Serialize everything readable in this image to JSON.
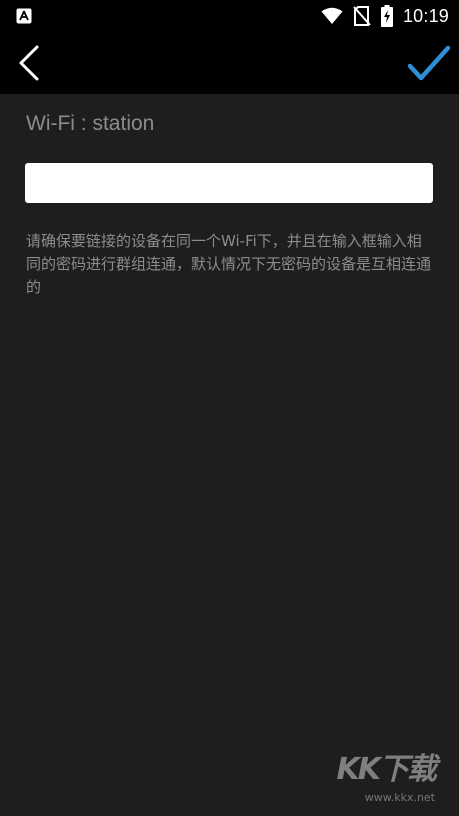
{
  "status_bar": {
    "time": "10:19",
    "icons": [
      "app-notification-icon",
      "wifi-icon",
      "no-sim-icon",
      "battery-charging-icon"
    ]
  },
  "toolbar": {
    "back_icon": "chevron-left-icon",
    "confirm_icon": "checkmark-icon",
    "accent_color": "#2f8fd6"
  },
  "form": {
    "wifi_label": "Wi-Fi : station",
    "password_value": "",
    "password_placeholder": "",
    "hint": "请确保要链接的设备在同一个Wi-Fi下，并且在输入框输入相同的密码进行群组连通，默认情况下无密码的设备是互相连通的"
  },
  "watermark": {
    "logo_text": "KK下载",
    "url": "www.kkx.net"
  }
}
